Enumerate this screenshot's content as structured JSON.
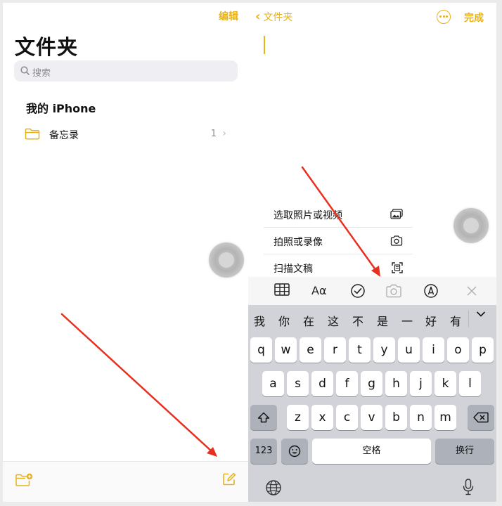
{
  "left": {
    "edit_label": "编辑",
    "title": "文件夹",
    "search_placeholder": "搜索",
    "section_title": "我的 iPhone",
    "folder": {
      "name": "备忘录",
      "count": "1"
    }
  },
  "right": {
    "back_label": "文件夹",
    "done_label": "完成",
    "attach_menu": [
      {
        "label": "选取照片或视频",
        "icon": "photo-icon"
      },
      {
        "label": "拍照或录像",
        "icon": "camera-icon"
      },
      {
        "label": "扫描文稿",
        "icon": "scan-icon"
      }
    ],
    "format_label": "Aα",
    "candidates": [
      "我",
      "你",
      "在",
      "这",
      "不",
      "是",
      "一",
      "好",
      "有"
    ],
    "keyboard": {
      "row1": [
        "q",
        "w",
        "e",
        "r",
        "t",
        "y",
        "u",
        "i",
        "o",
        "p"
      ],
      "row2": [
        "a",
        "s",
        "d",
        "f",
        "g",
        "h",
        "j",
        "k",
        "l"
      ],
      "row3": [
        "z",
        "x",
        "c",
        "v",
        "b",
        "n",
        "m"
      ],
      "numbers_label": "123",
      "space_label": "空格",
      "return_label": "换行"
    }
  },
  "colors": {
    "accent": "#e7b21a",
    "annotation_arrow": "#e8301f",
    "keyboard_bg": "#d1d3d9"
  }
}
